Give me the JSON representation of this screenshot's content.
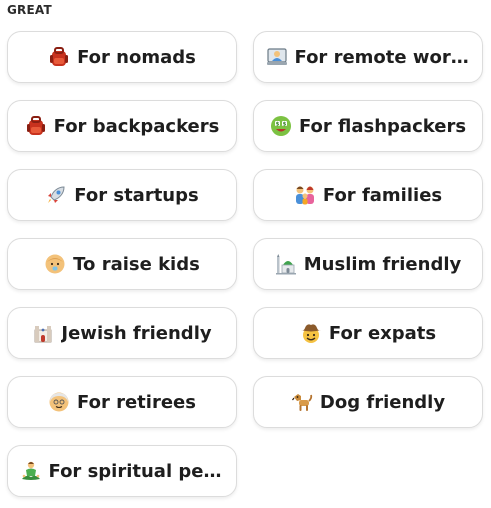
{
  "section": {
    "title": "GREAT"
  },
  "tags": [
    {
      "label": "For nomads",
      "icon": "backpack-icon"
    },
    {
      "label": "For remote work...",
      "icon": "laptop-worker-icon"
    },
    {
      "label": "For backpackers",
      "icon": "backpack-icon"
    },
    {
      "label": "For flashpackers",
      "icon": "money-face-icon"
    },
    {
      "label": "For startups",
      "icon": "rocket-icon"
    },
    {
      "label": "For families",
      "icon": "family-icon"
    },
    {
      "label": "To raise kids",
      "icon": "baby-icon"
    },
    {
      "label": "Muslim friendly",
      "icon": "mosque-icon"
    },
    {
      "label": "Jewish friendly",
      "icon": "synagogue-icon"
    },
    {
      "label": "For expats",
      "icon": "cowboy-icon"
    },
    {
      "label": "For retirees",
      "icon": "older-person-icon"
    },
    {
      "label": "Dog friendly",
      "icon": "dog-icon"
    },
    {
      "label": "For spiritual peo...",
      "icon": "meditation-icon"
    }
  ],
  "colors": {
    "border": "#dcdcdc",
    "text": "#1e1e1e",
    "background": "#ffffff"
  }
}
